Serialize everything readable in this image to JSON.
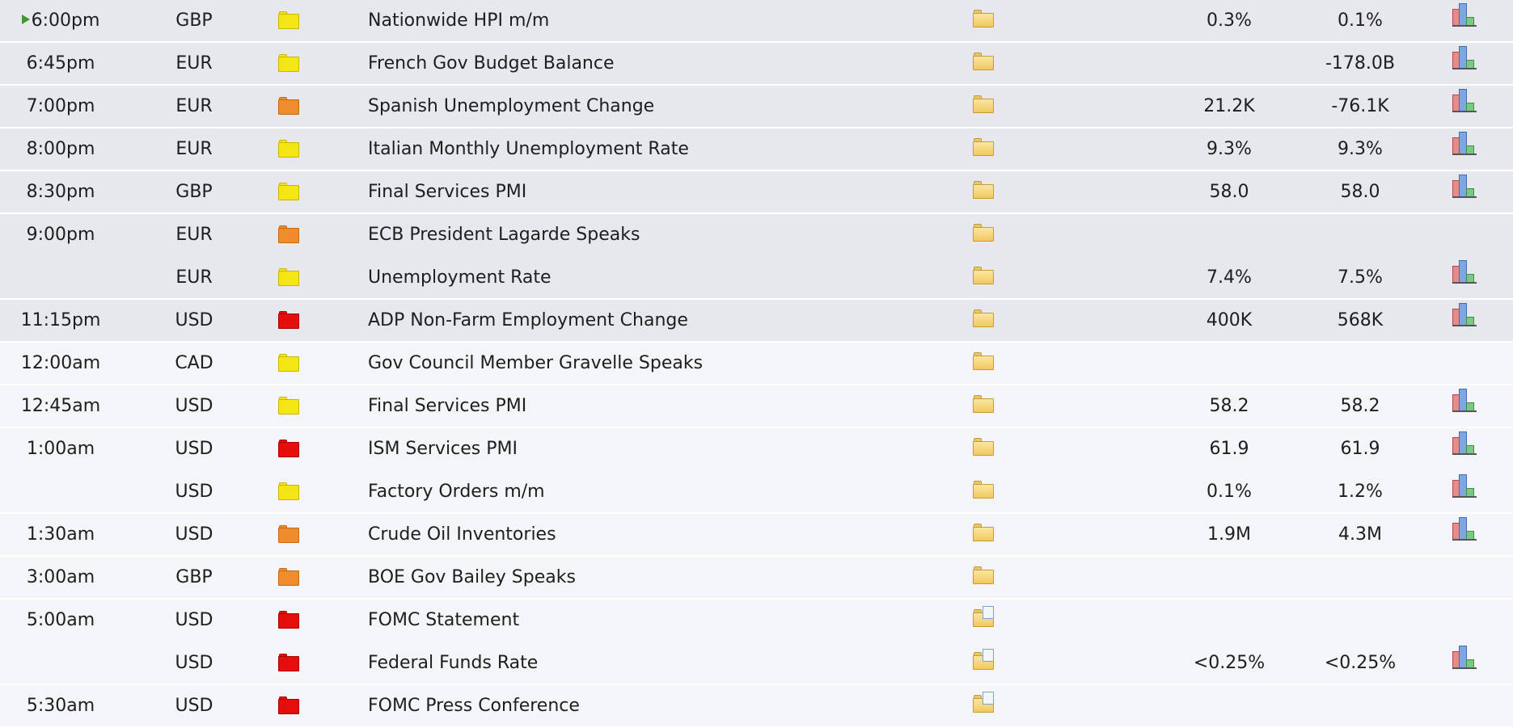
{
  "colors": {
    "impact_low": "#f4e514",
    "impact_medium": "#ef8c2e",
    "impact_high": "#e60d0d",
    "row_past_bg": "#e7e8ed",
    "row_future_bg": "#f4f5f8",
    "current_marker": "#3a9a2c"
  },
  "icons": {
    "impact": "impact-folder-icon",
    "detail": "detail-folder-icon",
    "graph": "bar-graph-icon",
    "current": "play-arrow-icon"
  },
  "rows": [
    {
      "time": "6:00pm",
      "currency": "GBP",
      "impact": "low",
      "title": "Nationwide HPI m/m",
      "folder": "plain",
      "actual": "0.3%",
      "forecast": "0.1%",
      "graph": true,
      "period": "past",
      "current": true
    },
    {
      "time": "6:45pm",
      "currency": "EUR",
      "impact": "low",
      "title": "French Gov Budget Balance",
      "folder": "plain",
      "actual": "",
      "forecast": "-178.0B",
      "graph": true,
      "period": "past"
    },
    {
      "time": "7:00pm",
      "currency": "EUR",
      "impact": "medium",
      "title": "Spanish Unemployment Change",
      "folder": "plain",
      "actual": "21.2K",
      "forecast": "-76.1K",
      "graph": true,
      "period": "past"
    },
    {
      "time": "8:00pm",
      "currency": "EUR",
      "impact": "low",
      "title": "Italian Monthly Unemployment Rate",
      "folder": "plain",
      "actual": "9.3%",
      "forecast": "9.3%",
      "graph": true,
      "period": "past"
    },
    {
      "time": "8:30pm",
      "currency": "GBP",
      "impact": "low",
      "title": "Final Services PMI",
      "folder": "plain",
      "actual": "58.0",
      "forecast": "58.0",
      "graph": true,
      "period": "past"
    },
    {
      "time": "9:00pm",
      "currency": "EUR",
      "impact": "medium",
      "title": "ECB President Lagarde Speaks",
      "folder": "plain",
      "actual": "",
      "forecast": "",
      "graph": false,
      "period": "past",
      "nosep": true
    },
    {
      "time": "",
      "currency": "EUR",
      "impact": "low",
      "title": "Unemployment Rate",
      "folder": "plain",
      "actual": "7.4%",
      "forecast": "7.5%",
      "graph": true,
      "period": "past"
    },
    {
      "time": "11:15pm",
      "currency": "USD",
      "impact": "high",
      "title": "ADP Non-Farm Employment Change",
      "folder": "plain",
      "actual": "400K",
      "forecast": "568K",
      "graph": true,
      "period": "past"
    },
    {
      "time": "12:00am",
      "currency": "CAD",
      "impact": "low",
      "title": "Gov Council Member Gravelle Speaks",
      "folder": "plain",
      "actual": "",
      "forecast": "",
      "graph": false,
      "period": "future"
    },
    {
      "time": "12:45am",
      "currency": "USD",
      "impact": "low",
      "title": "Final Services PMI",
      "folder": "plain",
      "actual": "58.2",
      "forecast": "58.2",
      "graph": true,
      "period": "future"
    },
    {
      "time": "1:00am",
      "currency": "USD",
      "impact": "high",
      "title": "ISM Services PMI",
      "folder": "plain",
      "actual": "61.9",
      "forecast": "61.9",
      "graph": true,
      "period": "future",
      "nosep": true
    },
    {
      "time": "",
      "currency": "USD",
      "impact": "low",
      "title": "Factory Orders m/m",
      "folder": "plain",
      "actual": "0.1%",
      "forecast": "1.2%",
      "graph": true,
      "period": "future"
    },
    {
      "time": "1:30am",
      "currency": "USD",
      "impact": "medium",
      "title": "Crude Oil Inventories",
      "folder": "plain",
      "actual": "1.9M",
      "forecast": "4.3M",
      "graph": true,
      "period": "future"
    },
    {
      "time": "3:00am",
      "currency": "GBP",
      "impact": "medium",
      "title": "BOE Gov Bailey Speaks",
      "folder": "plain",
      "actual": "",
      "forecast": "",
      "graph": false,
      "period": "future"
    },
    {
      "time": "5:00am",
      "currency": "USD",
      "impact": "high",
      "title": "FOMC Statement",
      "folder": "doc",
      "actual": "",
      "forecast": "",
      "graph": false,
      "period": "future",
      "nosep": true
    },
    {
      "time": "",
      "currency": "USD",
      "impact": "high",
      "title": "Federal Funds Rate",
      "folder": "doc",
      "actual": "<0.25%",
      "forecast": "<0.25%",
      "graph": true,
      "period": "future"
    },
    {
      "time": "5:30am",
      "currency": "USD",
      "impact": "high",
      "title": "FOMC Press Conference",
      "folder": "doc",
      "actual": "",
      "forecast": "",
      "graph": false,
      "period": "future"
    }
  ]
}
